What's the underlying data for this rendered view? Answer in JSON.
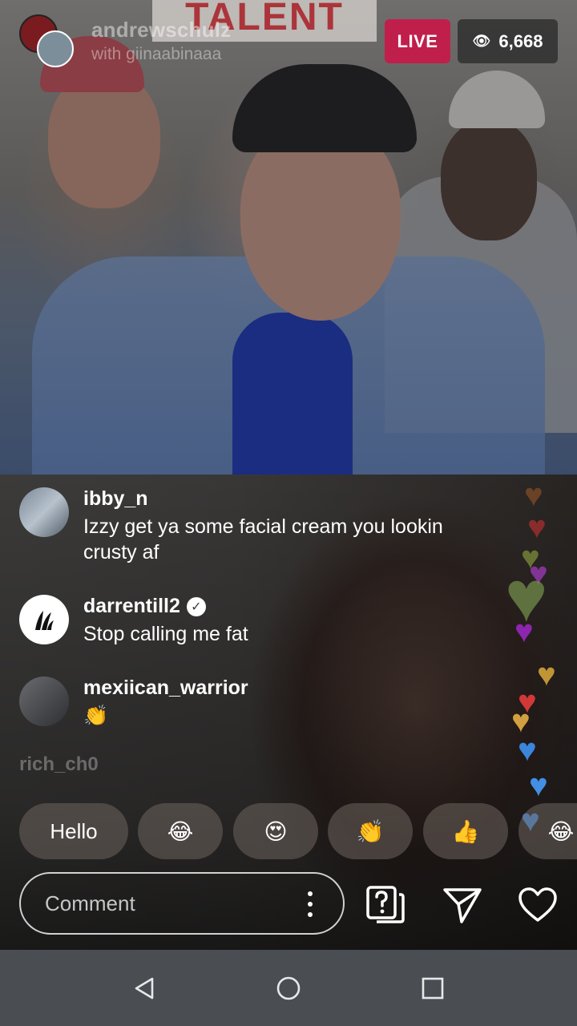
{
  "stream": {
    "host_username": "andrewschulz",
    "guest_line": "with giinaabinaaa",
    "live_label": "LIVE",
    "viewer_count": "6,668",
    "banner_text": "TALENT"
  },
  "comments": [
    {
      "username": "ibby_n",
      "text": "Izzy get ya some facial cream you lookin crusty af",
      "verified": false
    },
    {
      "username": "darrentill2",
      "text": "Stop calling me fat",
      "verified": true
    },
    {
      "username": "mexiican_warrior",
      "text": "👏",
      "verified": false
    }
  ],
  "faded_comment_username": "rich_ch0",
  "quick_reactions": [
    "Hello",
    "😂",
    "😍",
    "👏",
    "👍",
    "😂"
  ],
  "composer": {
    "placeholder": "Comment"
  },
  "icons": {
    "question": "question-sticker-icon",
    "share": "paper-plane-icon",
    "like": "heart-outline-icon",
    "more": "kebab-icon"
  },
  "colors": {
    "live_badge": "#c01f4b",
    "nav_bar": "#4a4d52"
  }
}
